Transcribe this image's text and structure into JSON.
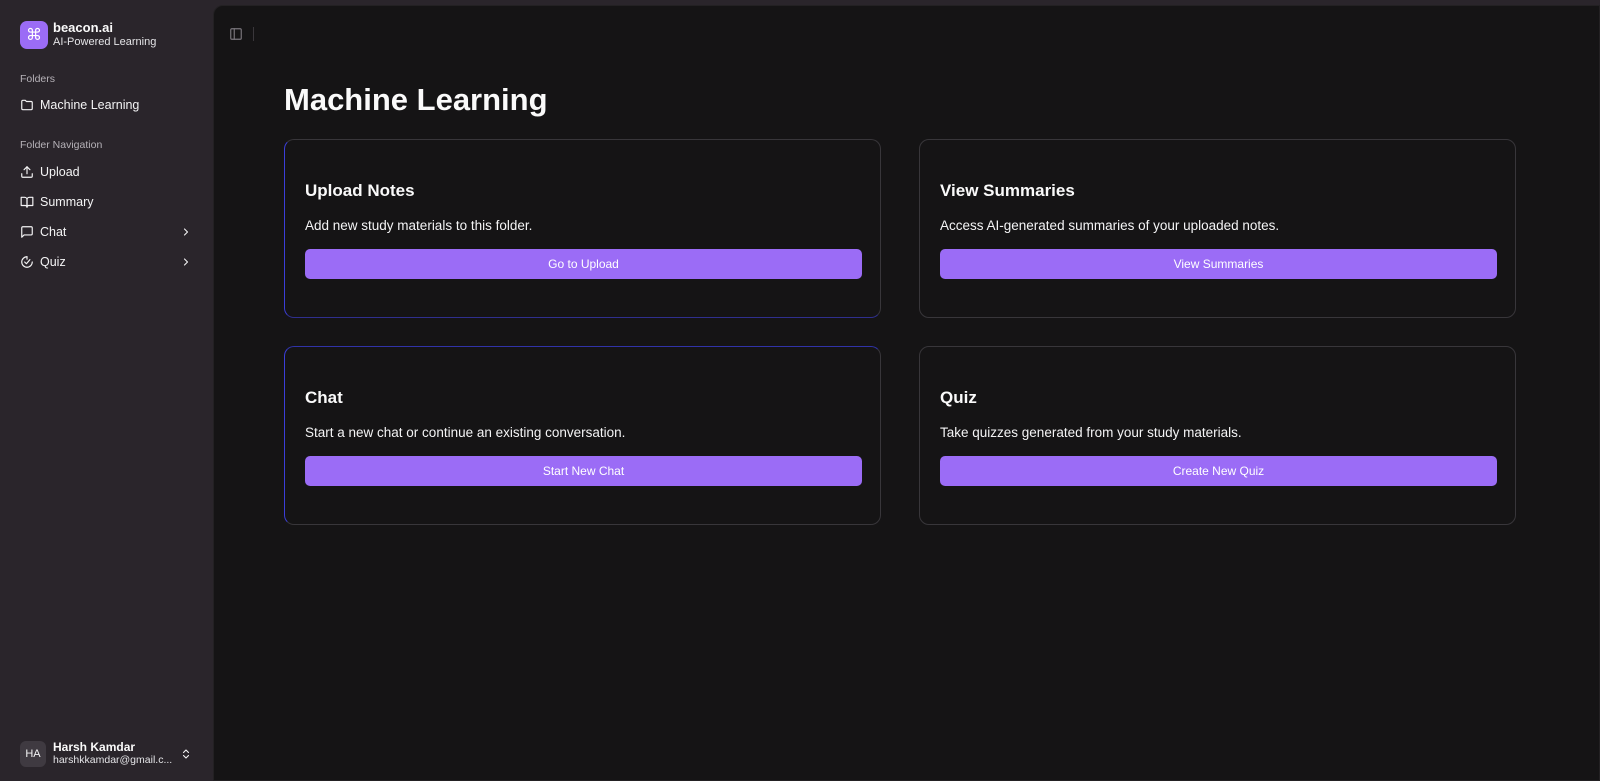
{
  "brand": {
    "logo_glyph": "⌘",
    "name": "beacon.ai",
    "tagline": "AI-Powered Learning",
    "color": "#9b6cf6"
  },
  "sidebar": {
    "folders_label": "Folders",
    "folders": [
      {
        "label": "Machine Learning",
        "icon": "folder-icon"
      }
    ],
    "nav_label": "Folder Navigation",
    "nav": [
      {
        "label": "Upload",
        "icon": "upload-icon"
      },
      {
        "label": "Summary",
        "icon": "book-open-icon"
      },
      {
        "label": "Chat",
        "icon": "message-square-icon",
        "has_submenu": true
      },
      {
        "label": "Quiz",
        "icon": "quiz-icon",
        "has_submenu": true
      }
    ]
  },
  "user": {
    "initials": "HA",
    "name": "Harsh Kamdar",
    "email": "harshkkamdar@gmail.c..."
  },
  "main": {
    "title": "Machine Learning",
    "cards": [
      {
        "title": "Upload Notes",
        "description": "Add new study materials to this folder.",
        "button": "Go to Upload"
      },
      {
        "title": "View Summaries",
        "description": "Access AI-generated summaries of your uploaded notes.",
        "button": "View Summaries"
      },
      {
        "title": "Chat",
        "description": "Start a new chat or continue an existing conversation.",
        "button": "Start New Chat"
      },
      {
        "title": "Quiz",
        "description": "Take quizzes generated from your study materials.",
        "button": "Create New Quiz"
      }
    ]
  },
  "colors": {
    "accent": "#9b6cf6",
    "sidebar_bg": "#2a252b",
    "main_bg": "#151415",
    "card_border": "#38363a"
  }
}
